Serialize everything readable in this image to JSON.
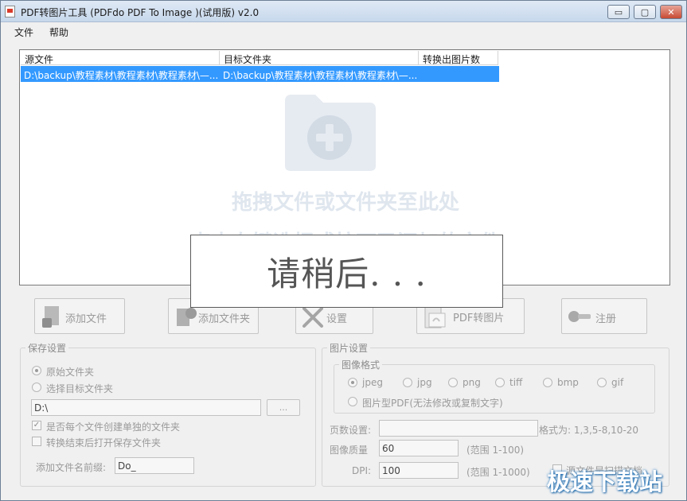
{
  "window": {
    "title": "PDF转图片工具 (PDFdo PDF To Image )(试用版) v2.0",
    "controls": {
      "minimize": "▭",
      "maximize": "▢",
      "close": "✕"
    }
  },
  "menu": {
    "items": [
      "文件",
      "帮助"
    ]
  },
  "file_list": {
    "columns": [
      "源文件",
      "目标文件夹",
      "转换出图片数"
    ],
    "rows": [
      {
        "source": "D:\\backup\\教程素材\\教程素材\\教程素材\\—...",
        "target": "D:\\backup\\教程素材\\教程素材\\教程素材\\—...",
        "count": ""
      }
    ],
    "drop_hint_line1": "拖拽文件或文件夹至此处",
    "drop_hint_line2": "点击右键选择或按下已添加的文件"
  },
  "overlay": {
    "text": "请稍后. . ."
  },
  "toolbar": {
    "add_file": "添加文件",
    "add_folder": "添加文件夹",
    "settings": "设置",
    "convert": "PDF转图片",
    "register": "注册"
  },
  "save_settings": {
    "title": "保存设置",
    "option_original": "原始文件夹",
    "option_target": "选择目标文件夹",
    "selected": "original",
    "path": "D:\\",
    "browse": "...",
    "create_subfolder_label": "是否每个文件创建单独的文件夹",
    "create_subfolder_checked": true,
    "open_when_done_label": "转换结束后打开保存文件夹",
    "open_when_done_checked": false,
    "prefix_label": "添加文件名前缀:",
    "prefix_value": "Do_"
  },
  "image_settings": {
    "title": "图片设置",
    "format_group_title": "图像格式",
    "formats": [
      "jpeg",
      "jpg",
      "png",
      "tiff",
      "bmp",
      "gif"
    ],
    "selected_format": "jpeg",
    "pdf_image_option": "图片型PDF(无法修改或复制文字)",
    "pages_label": "页数设置:",
    "pages_value": "",
    "pages_format_hint": "格式为: 1,3,5-8,10-20",
    "quality_label": "图像质量",
    "quality_value": "60",
    "quality_range": "(范围 1-100)",
    "dpi_label": "DPI:",
    "dpi_value": "100",
    "dpi_range": "(范围 1-1000)",
    "scan_option_label": "源文件是扫描文档"
  },
  "watermark": "极速下载站",
  "colors": {
    "selection": "#3399ff",
    "window_bg": "#f0f0f0",
    "title_gradient_top": "#dfe9f5"
  }
}
